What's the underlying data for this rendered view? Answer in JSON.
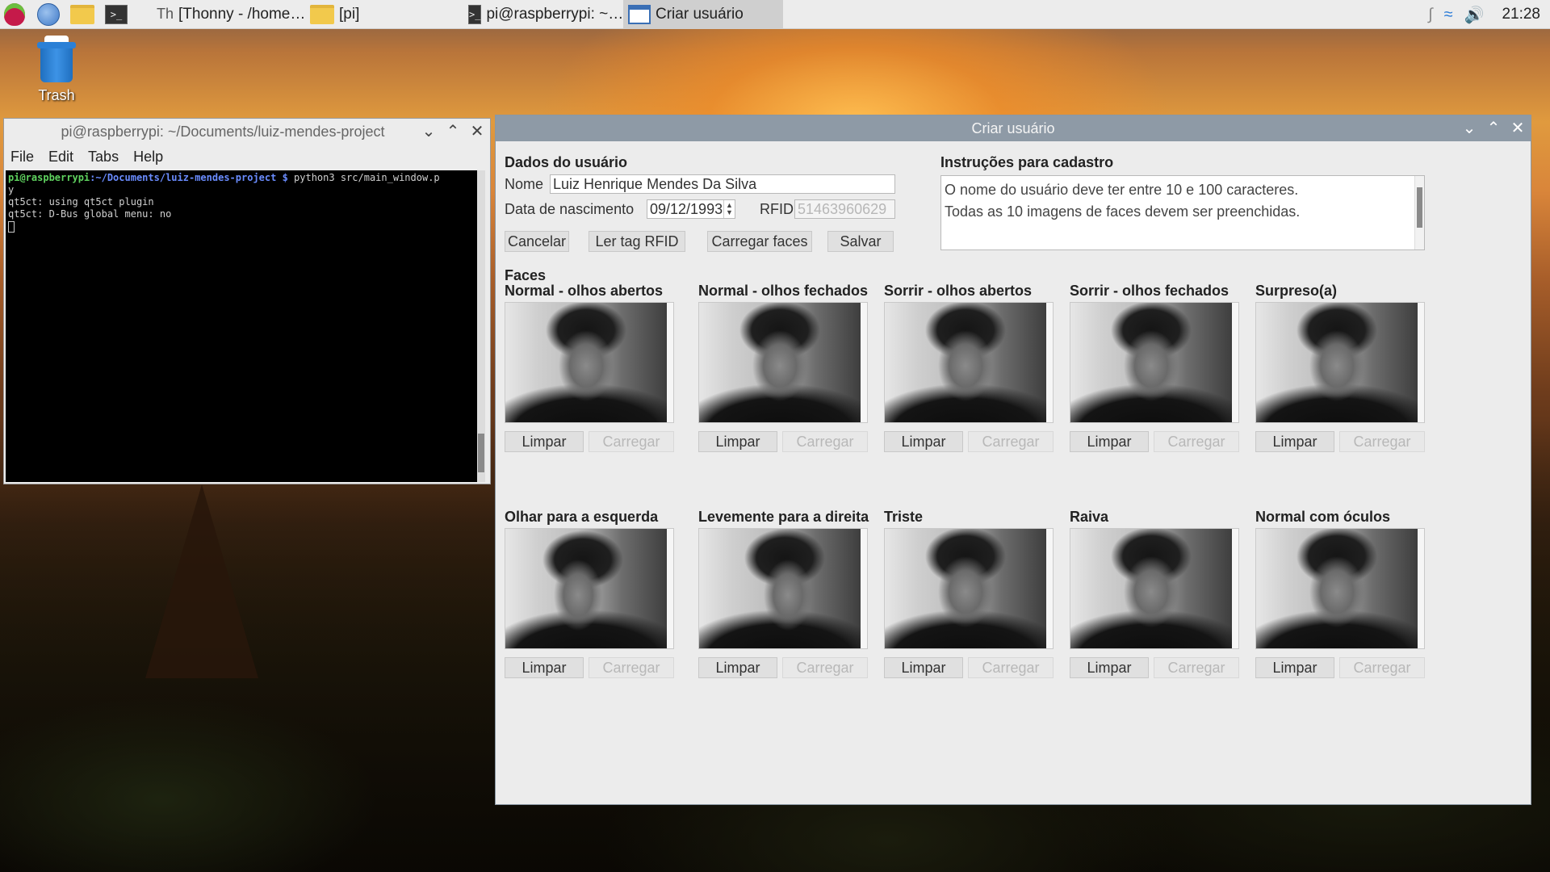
{
  "taskbar": {
    "tasks": [
      {
        "label": "[Thonny  -  /home…",
        "icon": "thonny-icon"
      },
      {
        "label": "[pi]",
        "icon": "folder-icon"
      },
      {
        "label": "pi@raspberrypi: ~…",
        "icon": "terminal-icon"
      },
      {
        "label": "Criar usuário",
        "icon": "window-icon",
        "active": true
      }
    ],
    "clock": "21:28"
  },
  "desktop": {
    "trash_label": "Trash"
  },
  "terminal": {
    "title": "pi@raspberrypi: ~/Documents/luiz-mendes-project",
    "menu": [
      "File",
      "Edit",
      "Tabs",
      "Help"
    ],
    "prompt_user": "pi@raspberrypi",
    "prompt_path": ":~/Documents/luiz-mendes-project $",
    "command": " python3 src/main_window.p",
    "command_wrap": "y",
    "output": [
      "qt5ct: using qt5ct plugin",
      "qt5ct: D-Bus global menu: no"
    ]
  },
  "app": {
    "title": "Criar usuário",
    "user_section_title": "Dados do usuário",
    "name_label": "Nome",
    "name_value": "Luiz Henrique Mendes Da Silva",
    "birth_label": "Data de nascimento",
    "birth_value": "09/12/1993",
    "rfid_label": "RFID",
    "rfid_value": "51463960629",
    "buttons": {
      "cancel": "Cancelar",
      "read_rfid": "Ler tag RFID",
      "load_faces": "Carregar faces",
      "save": "Salvar"
    },
    "instructions_title": "Instruções para cadastro",
    "instructions": [
      "O nome do usuário deve ter entre 10 e 100 caracteres.",
      "Todas as 10 imagens de faces devem ser preenchidas."
    ],
    "faces_title": "Faces",
    "clear_label": "Limpar",
    "load_label": "Carregar",
    "faces": [
      {
        "label": "Normal - olhos abertos"
      },
      {
        "label": "Normal - olhos fechados"
      },
      {
        "label": "Sorrir - olhos abertos"
      },
      {
        "label": "Sorrir - olhos fechados"
      },
      {
        "label": "Surpreso(a)"
      },
      {
        "label": "Olhar para a esquerda"
      },
      {
        "label": "Levemente para a direita"
      },
      {
        "label": "Triste"
      },
      {
        "label": "Raiva"
      },
      {
        "label": "Normal com óculos"
      }
    ]
  }
}
